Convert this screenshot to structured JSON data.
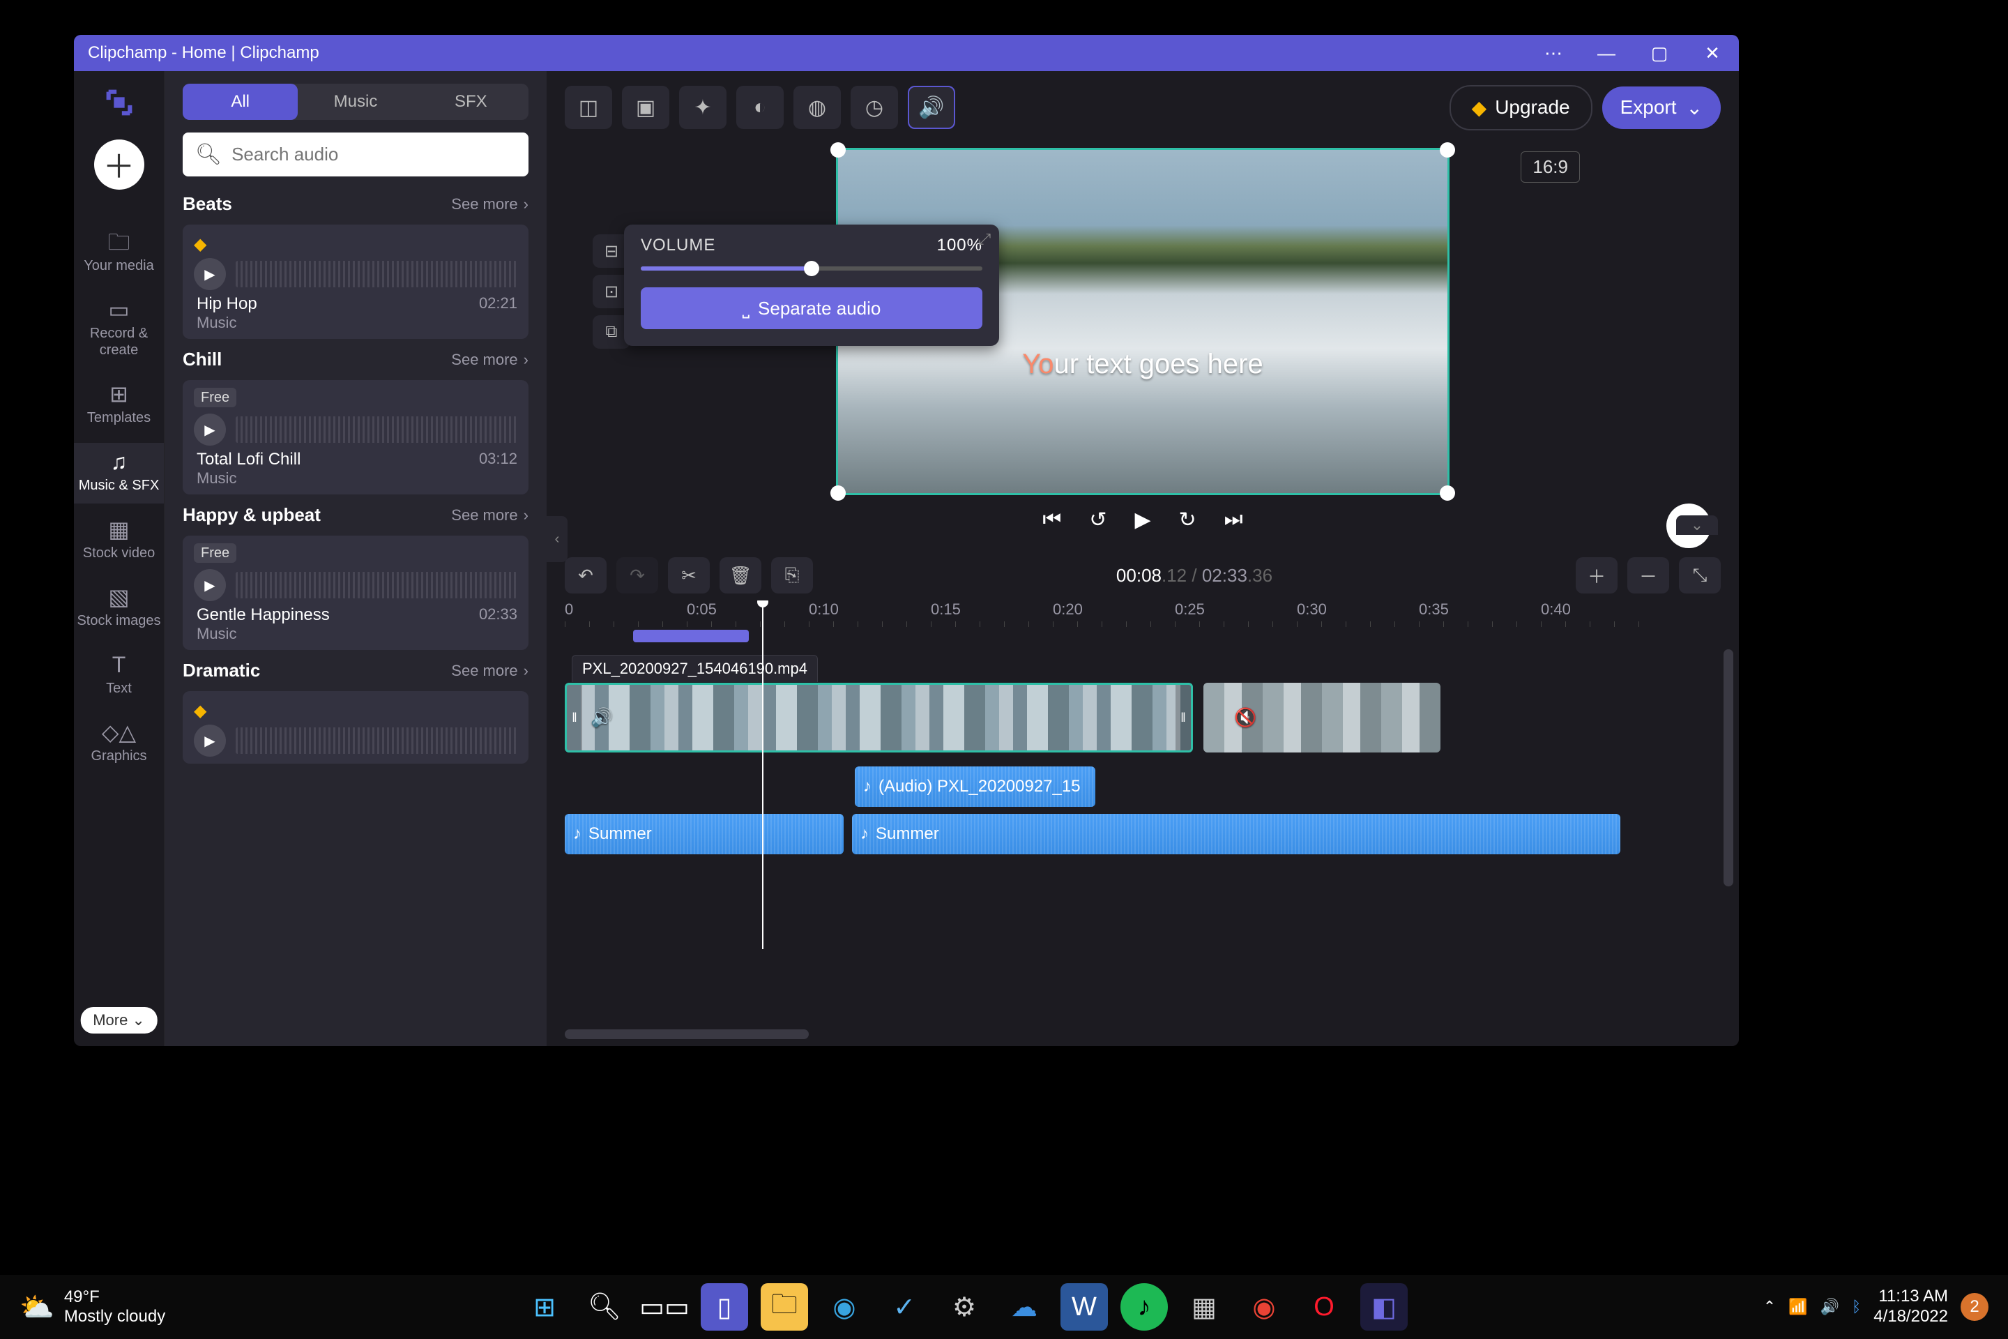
{
  "window": {
    "title": "Clipchamp - Home | Clipchamp"
  },
  "rail": {
    "items": [
      {
        "label": "Your media"
      },
      {
        "label": "Record & create"
      },
      {
        "label": "Templates"
      },
      {
        "label": "Music & SFX"
      },
      {
        "label": "Stock video"
      },
      {
        "label": "Stock images"
      },
      {
        "label": "Text"
      },
      {
        "label": "Graphics"
      }
    ],
    "more": "More"
  },
  "panel": {
    "tabs": {
      "all": "All",
      "music": "Music",
      "sfx": "SFX"
    },
    "search_placeholder": "Search audio",
    "see_more": "See more",
    "categories": [
      {
        "title": "Beats",
        "track": {
          "title": "Hip Hop",
          "sub": "Music",
          "duration": "02:21",
          "badge": "premium"
        }
      },
      {
        "title": "Chill",
        "track": {
          "title": "Total Lofi Chill",
          "sub": "Music",
          "duration": "03:12",
          "badge": "free"
        }
      },
      {
        "title": "Happy & upbeat",
        "track": {
          "title": "Gentle Happiness",
          "sub": "Music",
          "duration": "02:33",
          "badge": "free"
        }
      },
      {
        "title": "Dramatic",
        "track": {
          "title": "",
          "sub": "",
          "duration": "",
          "badge": "premium"
        }
      }
    ],
    "free_label": "Free"
  },
  "topbar": {
    "upgrade": "Upgrade",
    "export": "Export"
  },
  "preview": {
    "aspect": "16:9",
    "text_accent": "Yo",
    "text_rest": "ur text goes here"
  },
  "volume": {
    "label": "VOLUME",
    "value": "100%",
    "separate": "Separate audio"
  },
  "time": {
    "current": "00:08",
    "current_frac": ".12",
    "total": "02:33",
    "total_frac": ".36"
  },
  "ruler": [
    "0",
    "0:05",
    "0:10",
    "0:15",
    "0:20",
    "0:25",
    "0:30",
    "0:35",
    "0:40"
  ],
  "clips": {
    "video_label": "PXL_20200927_154046190.mp4",
    "audio1": "(Audio) PXL_20200927_15",
    "audio2": "Summer",
    "audio3": "Summer"
  },
  "taskbar": {
    "temp": "49°F",
    "cond": "Mostly cloudy",
    "time": "11:13 AM",
    "date": "4/18/2022",
    "notif": "2"
  }
}
